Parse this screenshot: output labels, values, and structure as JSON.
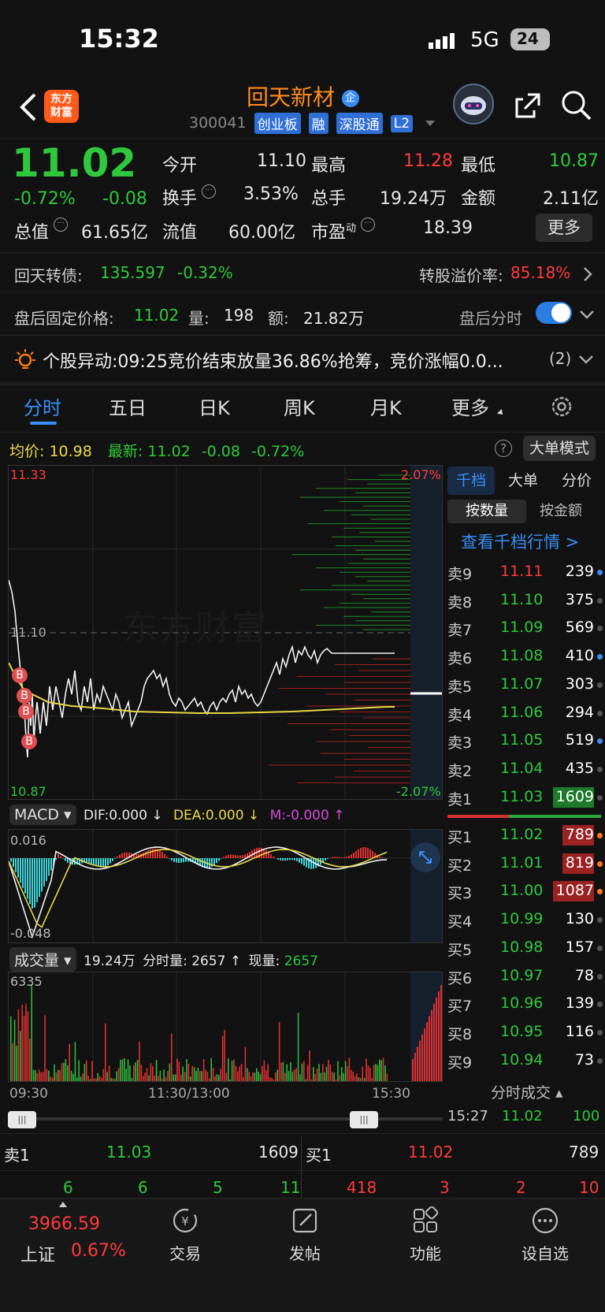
{
  "status": {
    "time": "15:32",
    "network": "5G",
    "battery": "24"
  },
  "header": {
    "name": "回天新材",
    "badge": "企",
    "code": "300041",
    "tags": [
      "创业板",
      "融",
      "深股通",
      "L2"
    ],
    "logo": "东方\n财富"
  },
  "quote": {
    "price": "11.02",
    "pct": "-0.72%",
    "chg": "-0.08",
    "row1": [
      {
        "k": "今开",
        "v": "11.10"
      },
      {
        "k": "最高",
        "v": "11.28"
      },
      {
        "k": "最低",
        "v": "10.87"
      }
    ],
    "row2": [
      {
        "k": "换手",
        "v": "3.53%"
      },
      {
        "k": "总手",
        "v": "19.24万"
      },
      {
        "k": "金额",
        "v": "2.11亿"
      }
    ],
    "row3": [
      {
        "k": "总值",
        "v": "61.65亿"
      },
      {
        "k": "流值",
        "v": "60.00亿"
      },
      {
        "k": "市盈",
        "sup": "动",
        "v": "18.39"
      }
    ],
    "more": "更多"
  },
  "bond": {
    "name": "回天转债:",
    "price": "135.597",
    "pct": "-0.32%",
    "premium_label": "转股溢价率:",
    "premium": "85.18%"
  },
  "after": {
    "label": "盘后固定价格:",
    "price": "11.02",
    "vol_label": "量:",
    "vol": "198",
    "amt_label": "额:",
    "amt": "21.82万",
    "toggle_label": "盘后分时",
    "toggle_on": true
  },
  "alert": {
    "label": "个股异动:",
    "text": "09:25竞价结束放量36.86%抢筹，竞价涨幅0.0...",
    "count": "(2)"
  },
  "tabs": [
    "分时",
    "五日",
    "日K",
    "周K",
    "月K",
    "更多"
  ],
  "avgline": {
    "avg_label": "均价:",
    "avg": "10.98",
    "new_label": "最新:",
    "new": "11.02",
    "chg": "-0.08",
    "pct": "-0.72%",
    "mode": "大单模式"
  },
  "chart": {
    "top": "11.33",
    "bottom": "10.87",
    "pct_top": "2.07%",
    "pct_bottom": "-2.07%",
    "ref": "11.10",
    "watermark": "东方财富",
    "macd": {
      "label": "MACD",
      "dif": "DIF:0.000 ↓",
      "dea": "DEA:0.000 ↓",
      "m": "M:-0.000 ↑",
      "top": "0.016",
      "bottom": "-0.048"
    },
    "vol": {
      "label": "成交量",
      "total": "19.24万",
      "fs_label": "分时量:",
      "fs": "2657 ↑",
      "now_label": "现量:",
      "now": "2657",
      "top": "6335"
    },
    "time_labels": [
      "09:30",
      "11:30/13:00",
      "15:30"
    ]
  },
  "book": {
    "tabs": [
      "千档",
      "大单",
      "分价"
    ],
    "subtabs": [
      "按数量",
      "按金额"
    ],
    "link": "查看千档行情 >",
    "asks": [
      {
        "l": "卖9",
        "p": "11.11",
        "v": "239"
      },
      {
        "l": "卖8",
        "p": "11.10",
        "v": "375"
      },
      {
        "l": "卖7",
        "p": "11.09",
        "v": "569"
      },
      {
        "l": "卖6",
        "p": "11.08",
        "v": "410"
      },
      {
        "l": "卖5",
        "p": "11.07",
        "v": "303"
      },
      {
        "l": "卖4",
        "p": "11.06",
        "v": "294"
      },
      {
        "l": "卖3",
        "p": "11.05",
        "v": "519"
      },
      {
        "l": "卖2",
        "p": "11.04",
        "v": "435"
      },
      {
        "l": "卖1",
        "p": "11.03",
        "v": "1609"
      }
    ],
    "bids": [
      {
        "l": "买1",
        "p": "11.02",
        "v": "789"
      },
      {
        "l": "买2",
        "p": "11.01",
        "v": "819"
      },
      {
        "l": "买3",
        "p": "11.00",
        "v": "1087"
      },
      {
        "l": "买4",
        "p": "10.99",
        "v": "130"
      },
      {
        "l": "买5",
        "p": "10.98",
        "v": "157"
      },
      {
        "l": "买6",
        "p": "10.97",
        "v": "78"
      },
      {
        "l": "买7",
        "p": "10.96",
        "v": "139"
      },
      {
        "l": "买8",
        "p": "10.95",
        "v": "116"
      },
      {
        "l": "买9",
        "p": "10.94",
        "v": "73"
      }
    ],
    "trades_label": "分时成交",
    "trade": {
      "t": "15:27",
      "p": "11.02",
      "v": "100"
    }
  },
  "level1": {
    "sell_label": "卖1",
    "sell_price": "11.03",
    "sell_vol": "1609",
    "buy_label": "买1",
    "buy_price": "11.02",
    "buy_vol": "789",
    "sell_counts": [
      "6",
      "6",
      "5",
      "11"
    ],
    "buy_counts": [
      "418",
      "3",
      "2",
      "10"
    ]
  },
  "nav": {
    "index_value": "3966.59",
    "index_name": "上证",
    "index_pct": "0.67%",
    "items": [
      "交易",
      "发帖",
      "功能",
      "设自选"
    ]
  },
  "colors": {
    "up": "#ff3b3b",
    "down": "#2fc83c",
    "avg": "#e6d84a",
    "accent": "#ff8a1f",
    "blue": "#3a8df5"
  }
}
